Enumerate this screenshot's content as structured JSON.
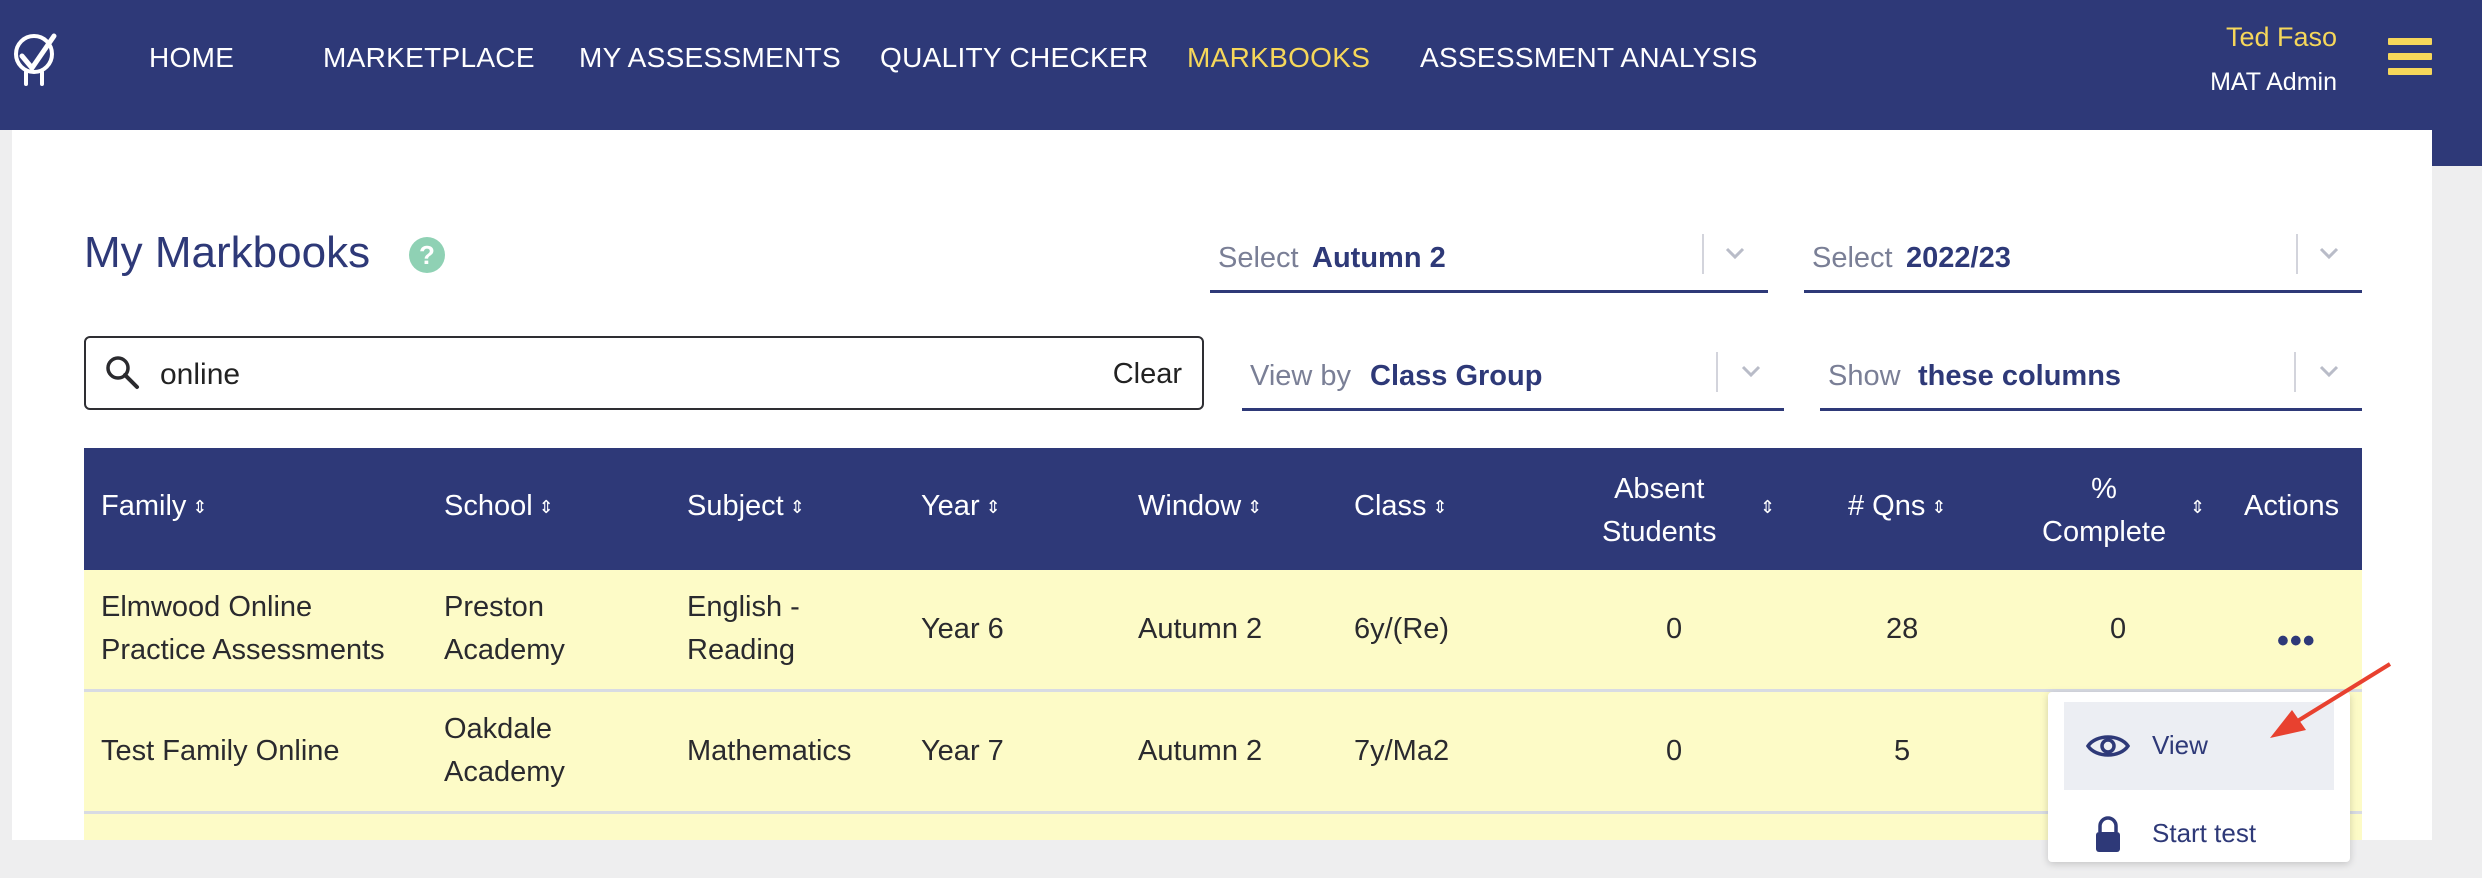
{
  "nav": {
    "home": "HOME",
    "marketplace": "MARKETPLACE",
    "my_assessments": "MY ASSESSMENTS",
    "quality_checker": "QUALITY CHECKER",
    "markbooks": "MARKBOOKS",
    "assessment_analysis": "ASSESSMENT ANALYSIS"
  },
  "user": {
    "name": "Ted Faso",
    "role": "MAT Admin"
  },
  "page": {
    "title": "My Markbooks",
    "help": "?"
  },
  "filters": {
    "term": {
      "label": "Select",
      "value": "Autumn 2"
    },
    "year": {
      "label": "Select",
      "value": "2022/23"
    },
    "view_by": {
      "label": "View by",
      "value": "Class Group"
    },
    "show": {
      "label": "Show",
      "value": "these columns"
    }
  },
  "search": {
    "value": "online",
    "clear_label": "Clear"
  },
  "table": {
    "headers": {
      "family": "Family",
      "school": "School",
      "subject": "Subject",
      "year": "Year",
      "window": "Window",
      "class": "Class",
      "absent_1": "Absent",
      "absent_2": "Students",
      "qns": "# Qns",
      "complete_1": "%",
      "complete_2": "Complete",
      "actions": "Actions"
    },
    "sort_glyph": "⌃⌄",
    "rows": [
      {
        "family_1": "Elmwood Online",
        "family_2": "Practice Assessments",
        "school_1": "Preston",
        "school_2": "Academy",
        "subject_1": "English -",
        "subject_2": "Reading",
        "year": "Year 6",
        "window": "Autumn 2",
        "class": "6y/(Re)",
        "absent": "0",
        "qns": "28",
        "complete": "0",
        "actions": "•••"
      },
      {
        "family_1": "Test Family Online",
        "school_1": "Oakdale",
        "school_2": "Academy",
        "subject_1": "Mathematics",
        "year": "Year 7",
        "window": "Autumn 2",
        "class": "7y/Ma2",
        "absent": "0",
        "qns": "5"
      }
    ]
  },
  "actions_menu": {
    "view": "View",
    "start_test": "Start test"
  },
  "colors": {
    "navy": "#2e3978",
    "accent_yellow": "#f6d75a",
    "row_yellow": "#fdfbc7",
    "help_green": "#8fd1b4",
    "arrow_red": "#e8412f"
  }
}
